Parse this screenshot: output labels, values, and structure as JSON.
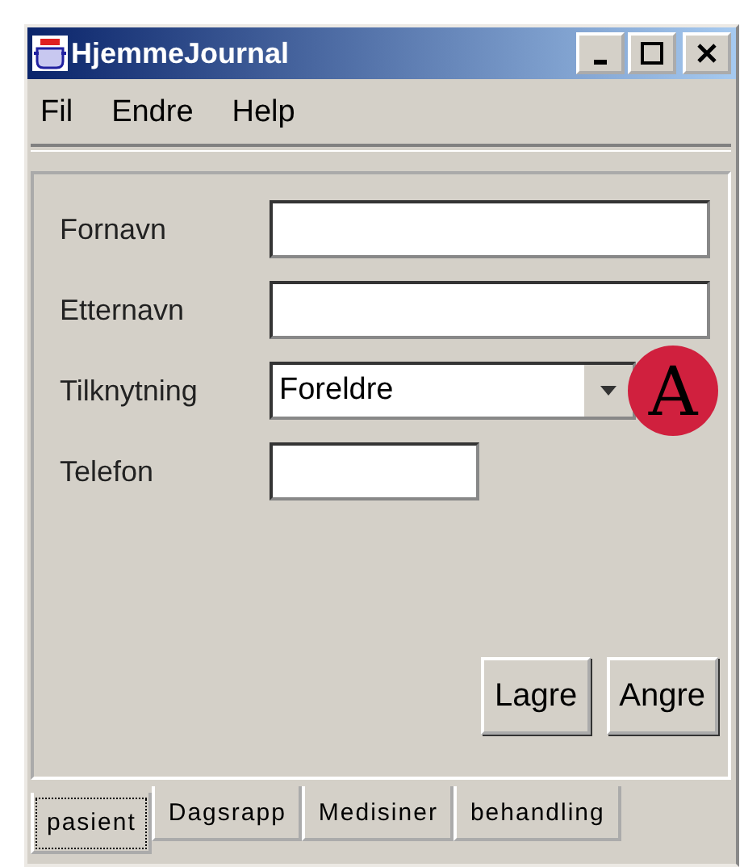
{
  "window": {
    "title": "HjemmeJournal"
  },
  "menu": [
    "Fil",
    "Endre",
    "Help"
  ],
  "fields": [
    {
      "kind": "text",
      "label": "Fornavn"
    },
    {
      "kind": "text",
      "label": "Etternavn"
    },
    {
      "kind": "combo",
      "label": "Tilknytning",
      "value": "Foreldre"
    },
    {
      "kind": "short",
      "label": "Telefon"
    }
  ],
  "annotation": "A",
  "buttons": [
    "Lagre",
    "Angre"
  ],
  "tabs": [
    {
      "label": "pasient",
      "selected": true
    },
    {
      "label": "Dagsrapp",
      "selected": false
    },
    {
      "label": "Medisiner",
      "selected": false
    },
    {
      "label": "behandling",
      "selected": false
    }
  ]
}
